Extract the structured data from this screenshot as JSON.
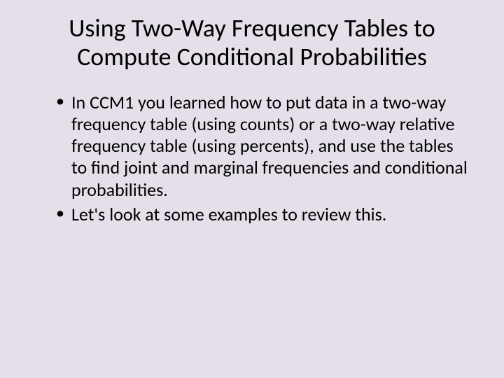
{
  "slide": {
    "title": "Using Two-Way Frequency Tables to Compute Conditional Probabilities",
    "bullets": [
      "In CCM1 you learned how to put data in a two-way frequency table (using counts) or a two-way relative frequency table (using percents), and use the tables to find joint and marginal frequencies and conditional probabilities.",
      "Let's look at some examples to review this."
    ]
  }
}
